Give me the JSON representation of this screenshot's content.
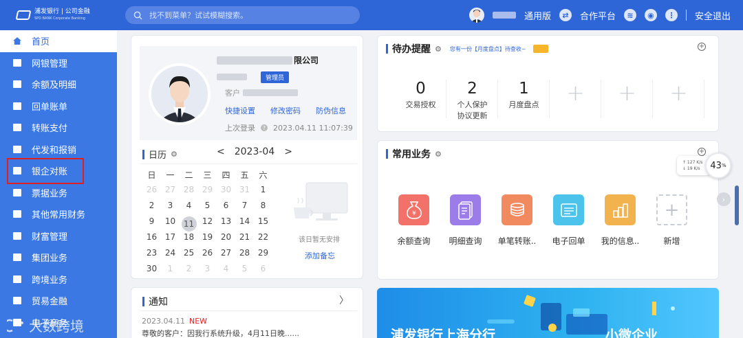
{
  "header": {
    "brand_line1": "浦发银行 | 公司金融",
    "brand_line2": "SPD BANK  Corporate Banking",
    "search_placeholder": "找不到菜单？试试模糊搜索。",
    "version_label": "通用版",
    "partner_label": "合作平台",
    "logout_label": "安全退出"
  },
  "sidebar": {
    "items": [
      {
        "label": "首页"
      },
      {
        "label": "网银管理"
      },
      {
        "label": "余额及明细"
      },
      {
        "label": "回单账单"
      },
      {
        "label": "转账支付"
      },
      {
        "label": "代发和报销"
      },
      {
        "label": "银企对账"
      },
      {
        "label": "票据业务"
      },
      {
        "label": "其他常用财务"
      },
      {
        "label": "财富管理"
      },
      {
        "label": "集团业务"
      },
      {
        "label": "跨境业务"
      },
      {
        "label": "贸易金融"
      },
      {
        "label": "电子商务"
      }
    ]
  },
  "profile": {
    "company_suffix": "限公司",
    "role": "管理员",
    "customer_prefix": "客户",
    "links": [
      "快捷设置",
      "修改密码",
      "防伪信息"
    ],
    "last_login_label": "上次登录",
    "last_login_time": "2023.04.11 11:07:39"
  },
  "calendar": {
    "title": "日历",
    "prev": "<",
    "month": "2023-04",
    "next": ">",
    "weekdays": [
      "日",
      "一",
      "二",
      "三",
      "四",
      "五",
      "六"
    ],
    "days": [
      [
        "26",
        "27",
        "28",
        "29",
        "30",
        "31",
        "1"
      ],
      [
        "2",
        "3",
        "4",
        "5",
        "6",
        "7",
        "8"
      ],
      [
        "9",
        "10",
        "11",
        "12",
        "13",
        "14",
        "15"
      ],
      [
        "16",
        "17",
        "18",
        "19",
        "20",
        "21",
        "22"
      ],
      [
        "23",
        "24",
        "25",
        "26",
        "27",
        "28",
        "29"
      ],
      [
        "30",
        "1",
        "2",
        "3",
        "4",
        "5",
        "6"
      ]
    ],
    "today": "11",
    "empty_text": "该日暂无安排",
    "add_memo": "添加备忘"
  },
  "todo": {
    "title": "待办提醒",
    "hint": "您有一份【月度盘点】待查收~",
    "items": [
      {
        "num": "0",
        "label": "交易授权"
      },
      {
        "num": "2",
        "label": "个人保护\n协议更新"
      },
      {
        "num": "1",
        "label": "月度盘点"
      }
    ],
    "plus": "+"
  },
  "common": {
    "title": "常用业务",
    "items": [
      {
        "label": "余额查询",
        "color": "#f27269",
        "icon": "money-bag-icon"
      },
      {
        "label": "明细查询",
        "color": "#9b7ce8",
        "icon": "document-icon"
      },
      {
        "label": "单笔转账..",
        "color": "#f28a60",
        "icon": "coins-icon"
      },
      {
        "label": "电子回单",
        "color": "#4cc3ea",
        "icon": "receipt-icon"
      },
      {
        "label": "我的信息..",
        "color": "#f2b24e",
        "icon": "chart-icon"
      }
    ],
    "add_label": "新增"
  },
  "notice": {
    "title": "通知",
    "date": "2023.04.11",
    "new_tag": "NEW",
    "text": "尊敬的客户：因我行系统升级，4月11日晚......"
  },
  "banner": {
    "text_left": "浦发银行上海分行",
    "text_right": "小微企业"
  },
  "speed": {
    "up": "↑ 127 K/s",
    "down": "↓ 19 K/s",
    "percent": "43",
    "percent_unit": "%"
  },
  "watermark": "大数跨境",
  "colors": {
    "primary": "#2e66d8",
    "sidebar": "#3b78e3",
    "highlight": "#e02020"
  }
}
